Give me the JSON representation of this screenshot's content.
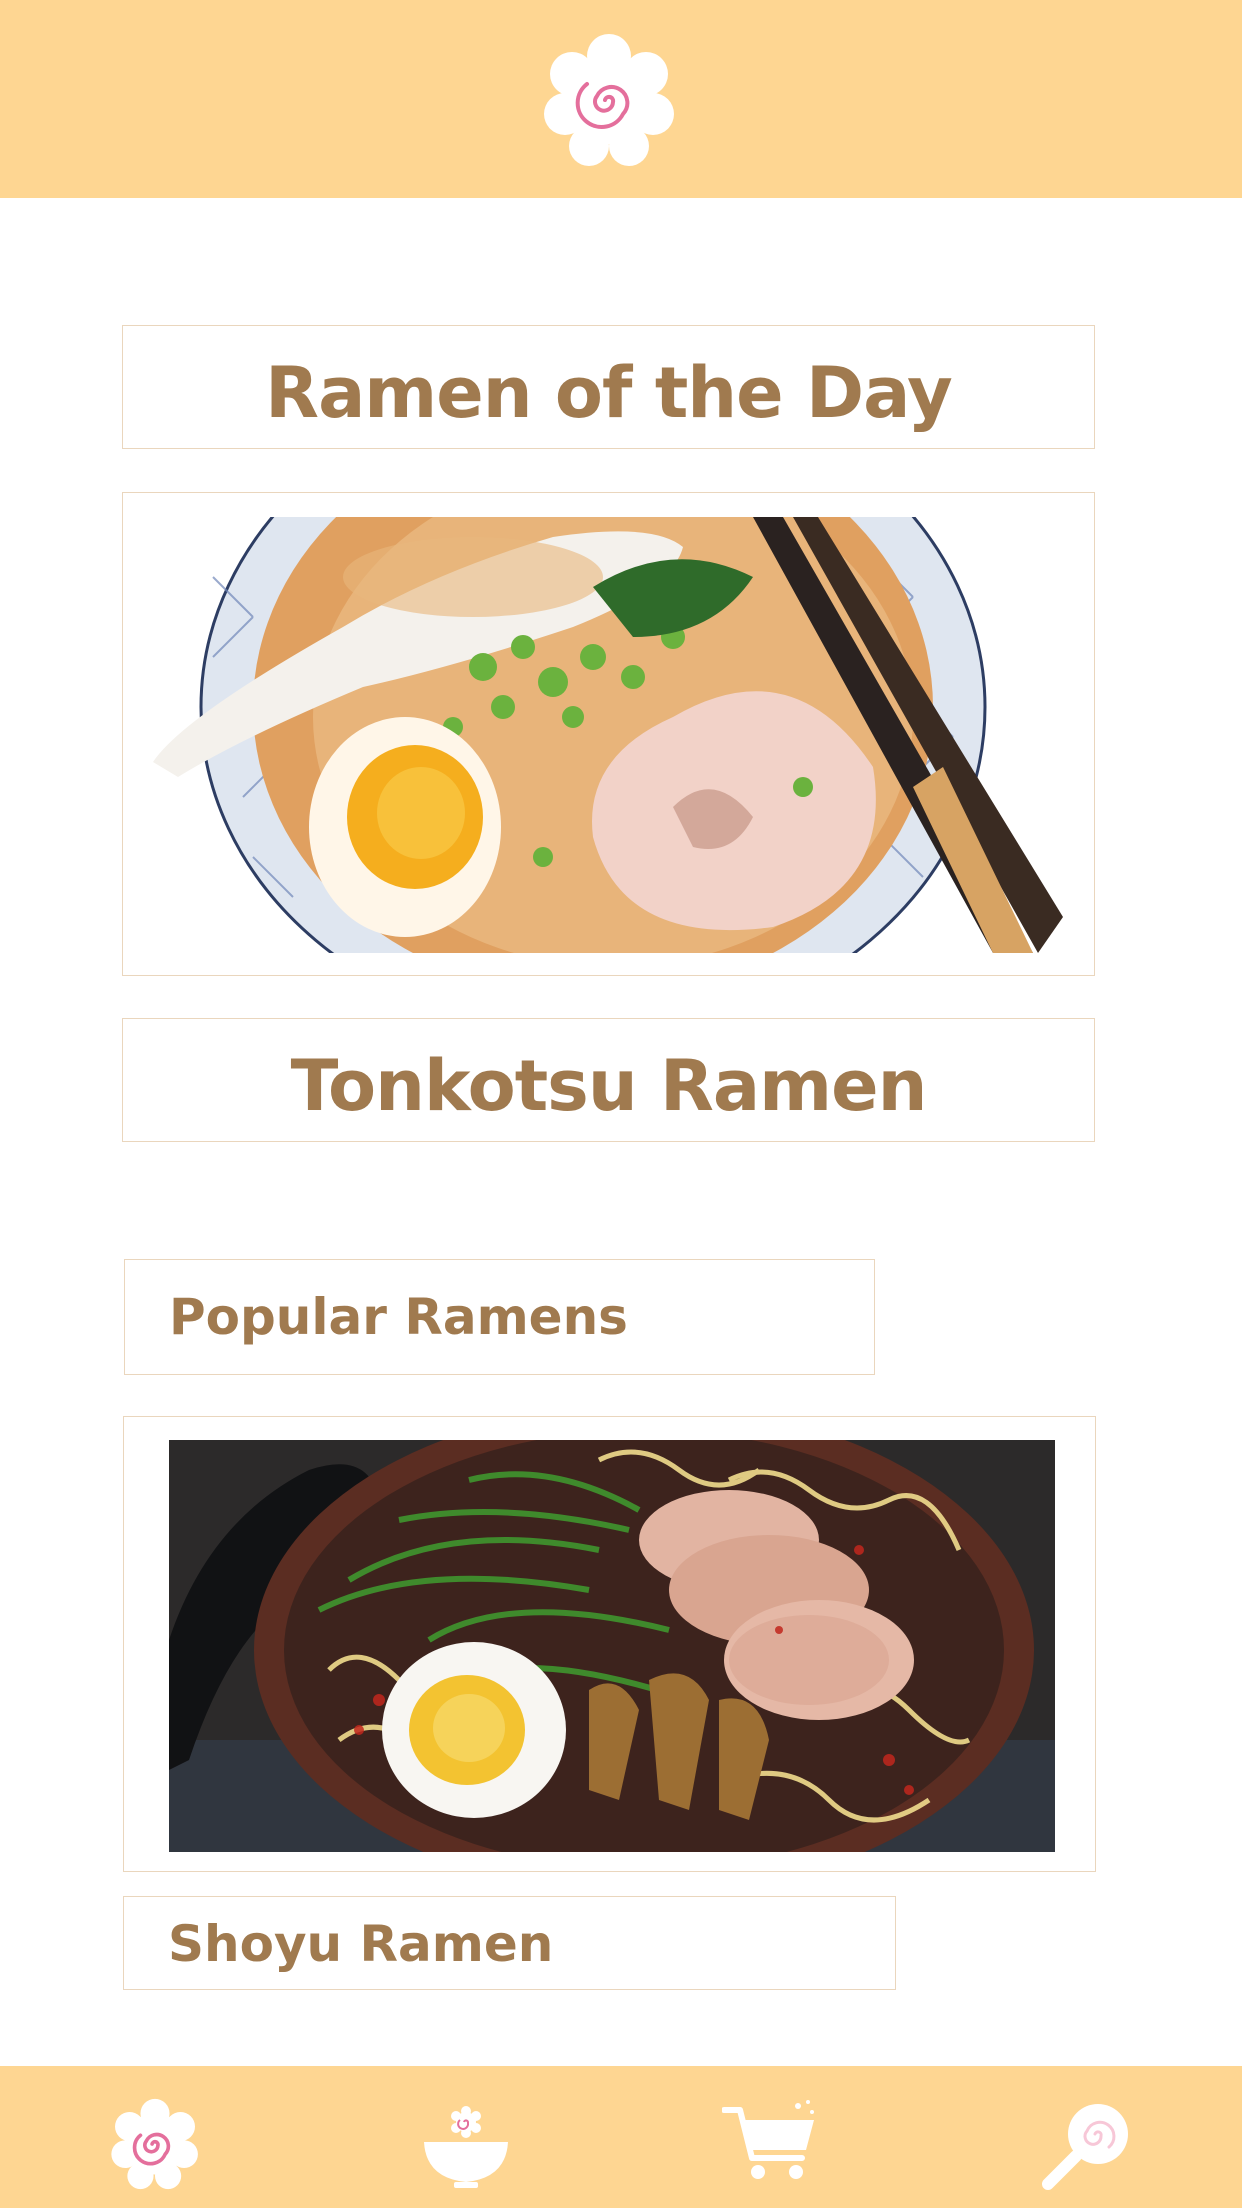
{
  "header": {
    "logo": "naruto-swirl-logo"
  },
  "featured": {
    "heading": "Ramen of the Day",
    "image": "tonkotsu-ramen-bowl-photo",
    "name": "Tonkotsu Ramen"
  },
  "popular": {
    "heading": "Popular Ramens",
    "items": [
      {
        "image": "shoyu-ramen-bowl-photo",
        "name": "Shoyu Ramen"
      }
    ]
  },
  "tabbar": {
    "items": [
      {
        "icon": "naruto-home-icon"
      },
      {
        "icon": "ramen-bowl-icon"
      },
      {
        "icon": "shopping-cart-icon"
      },
      {
        "icon": "search-lollipop-icon"
      }
    ]
  },
  "colors": {
    "header_bg": "#fed692",
    "accent_text": "#a07a4f",
    "box_border": "#ead6bd",
    "naruto_pink": "#e46f9c"
  }
}
